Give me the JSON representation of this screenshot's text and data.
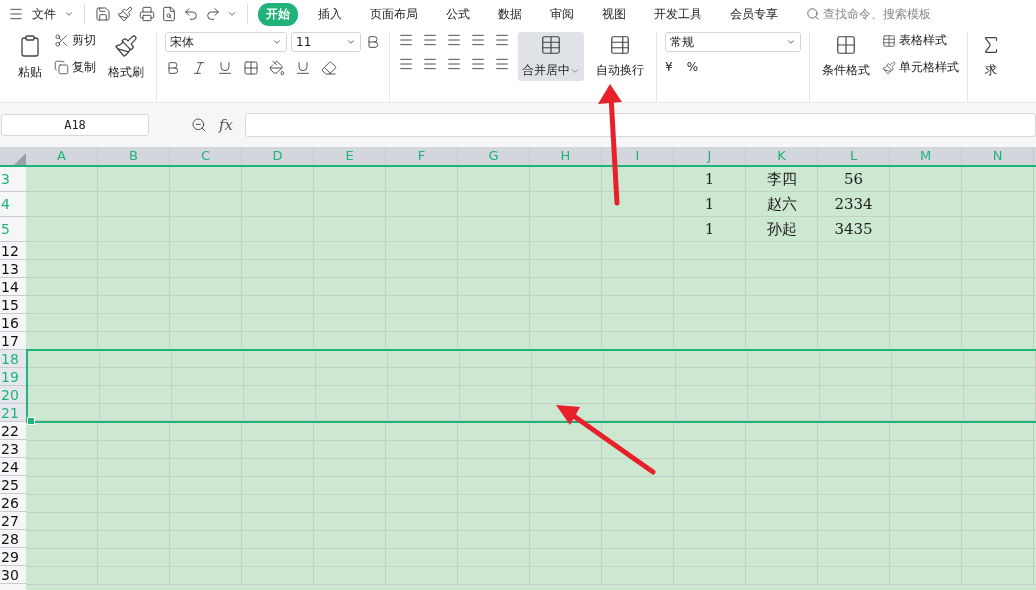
{
  "menu": {
    "label": "文件"
  },
  "tabs": [
    {
      "label": "开始",
      "selected": true
    },
    {
      "label": "插入",
      "selected": false
    },
    {
      "label": "页面布局",
      "selected": false
    },
    {
      "label": "公式",
      "selected": false
    },
    {
      "label": "数据",
      "selected": false
    },
    {
      "label": "审阅",
      "selected": false
    },
    {
      "label": "视图",
      "selected": false
    },
    {
      "label": "开发工具",
      "selected": false
    },
    {
      "label": "会员专享",
      "selected": false
    }
  ],
  "search": {
    "placeholder": "查找命令、搜索模板"
  },
  "ribbon": {
    "paste": "粘贴",
    "cut": "剪切",
    "copy": "复制",
    "format_painter": "格式刷",
    "font_name": "宋体",
    "font_size": "11",
    "merge": {
      "label": "合并居中",
      "selected": true
    },
    "wrap": "自动换行",
    "number_format": "常规",
    "currency": "¥",
    "percent": "%",
    "conditional_format": "条件格式",
    "table_style": "表格样式",
    "cell_style": "单元格样式",
    "sum": "求"
  },
  "name_box": "A18",
  "function_label": "fx",
  "columns": [
    "A",
    "B",
    "C",
    "D",
    "E",
    "F",
    "G",
    "H",
    "I",
    "J",
    "K",
    "L",
    "M",
    "N"
  ],
  "rows": [
    {
      "label": "3",
      "tall": true,
      "highlighted": true,
      "selected": false,
      "cells": [
        null,
        null,
        null,
        null,
        null,
        null,
        null,
        null,
        null,
        "1",
        "李四",
        "56"
      ]
    },
    {
      "label": "4",
      "tall": true,
      "highlighted": true,
      "selected": false,
      "cells": [
        null,
        null,
        null,
        null,
        null,
        null,
        null,
        null,
        null,
        "1",
        "赵六",
        "2334"
      ]
    },
    {
      "label": "5",
      "tall": true,
      "highlighted": true,
      "selected": false,
      "cells": [
        null,
        null,
        null,
        null,
        null,
        null,
        null,
        null,
        null,
        "1",
        "孙起",
        "3435"
      ]
    },
    {
      "label": "12",
      "tall": false,
      "highlighted": false,
      "selected": false
    },
    {
      "label": "13",
      "tall": false,
      "highlighted": false,
      "selected": false
    },
    {
      "label": "14",
      "tall": false,
      "highlighted": false,
      "selected": false
    },
    {
      "label": "15",
      "tall": false,
      "highlighted": false,
      "selected": false
    },
    {
      "label": "16",
      "tall": false,
      "highlighted": false,
      "selected": false
    },
    {
      "label": "17",
      "tall": false,
      "highlighted": false,
      "selected": false
    },
    {
      "label": "18",
      "tall": false,
      "highlighted": false,
      "selected": true
    },
    {
      "label": "19",
      "tall": false,
      "highlighted": false,
      "selected": true
    },
    {
      "label": "20",
      "tall": false,
      "highlighted": false,
      "selected": true
    },
    {
      "label": "21",
      "tall": false,
      "highlighted": false,
      "selected": true
    },
    {
      "label": "22",
      "tall": false,
      "highlighted": false,
      "selected": false
    },
    {
      "label": "23",
      "tall": false,
      "highlighted": false,
      "selected": false
    },
    {
      "label": "24",
      "tall": false,
      "highlighted": false,
      "selected": false
    },
    {
      "label": "25",
      "tall": false,
      "highlighted": false,
      "selected": false
    },
    {
      "label": "26",
      "tall": false,
      "highlighted": false,
      "selected": false
    },
    {
      "label": "27",
      "tall": false,
      "highlighted": false,
      "selected": false
    },
    {
      "label": "28",
      "tall": false,
      "highlighted": false,
      "selected": false
    },
    {
      "label": "29",
      "tall": false,
      "highlighted": false,
      "selected": false
    },
    {
      "label": "30",
      "tall": false,
      "highlighted": false,
      "selected": false
    }
  ]
}
